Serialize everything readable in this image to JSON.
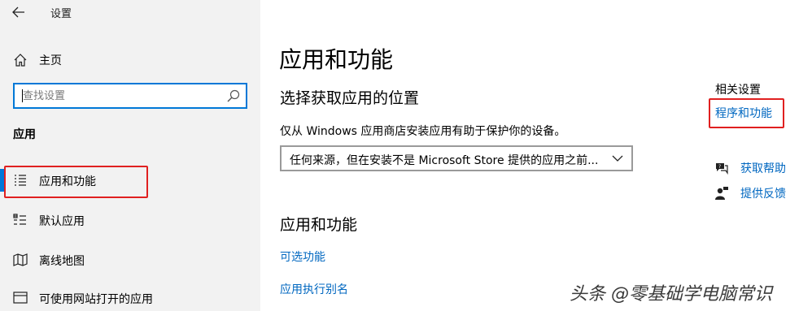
{
  "window": {
    "title": "设置"
  },
  "sidebar": {
    "home_label": "主页",
    "search_placeholder": "查找设置",
    "section_title": "应用",
    "items": [
      {
        "label": "应用和功能",
        "icon": "apps-list-icon",
        "active": true
      },
      {
        "label": "默认应用",
        "icon": "default-apps-icon"
      },
      {
        "label": "离线地图",
        "icon": "offline-map-icon"
      },
      {
        "label": "可使用网站打开的应用",
        "icon": "website-apps-icon"
      }
    ]
  },
  "main": {
    "title": "应用和功能",
    "install_section": {
      "title": "选择获取应用的位置",
      "description": "仅从 Windows 应用商店安装应用有助于保护你的设备。",
      "dropdown_value": "任何来源，但在安装不是 Microsoft Store 提供的应用之前..."
    },
    "apps_section": {
      "title": "应用和功能",
      "links": [
        "可选功能",
        "应用执行别名"
      ]
    }
  },
  "related": {
    "title": "相关设置",
    "link": "程序和功能",
    "help_items": [
      {
        "label": "获取帮助",
        "icon": "help-chat-icon"
      },
      {
        "label": "提供反馈",
        "icon": "feedback-icon"
      }
    ]
  },
  "watermark": "头条 @零基础学电脑常识",
  "colors": {
    "accent": "#0078d7",
    "link": "#0067c0",
    "highlight_box": "#e02020",
    "sidebar_bg": "#f2f2f2"
  }
}
